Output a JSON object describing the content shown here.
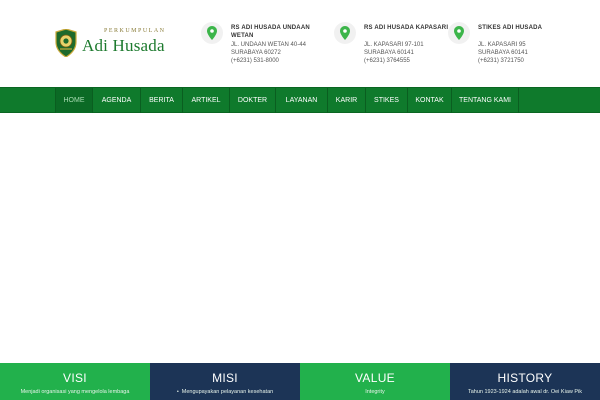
{
  "brand": {
    "tagline": "PERKUMPULAN",
    "name": "Adi Husada",
    "green": "#1d7a2e",
    "nav_green": "#0f7a2c"
  },
  "contacts": [
    {
      "name": "RS ADI HUSADA UNDAAN WETAN",
      "address": "JL. UNDAAN WETAN 40-44",
      "city": "SURABAYA 60272",
      "phone": "(+6231) 531-8000",
      "icon": "map-pin-icon"
    },
    {
      "name": "RS ADI HUSADA KAPASARI",
      "address": "JL. KAPASARI 97-101",
      "city": "SURABAYA 60141",
      "phone": "(+6231) 3764555",
      "icon": "map-pin-icon"
    },
    {
      "name": "STIKES ADI HUSADA",
      "address": "JL. KAPASARI 95",
      "city": "SURABAYA 60141",
      "phone": "(+6231) 3721750",
      "icon": "map-pin-icon"
    }
  ],
  "nav": {
    "items": [
      {
        "label": "HOME",
        "active": true
      },
      {
        "label": "AGENDA"
      },
      {
        "label": "BERITA"
      },
      {
        "label": "ARTIKEL"
      },
      {
        "label": "DOKTER"
      },
      {
        "label": "LAYANAN"
      },
      {
        "label": "KARIR"
      },
      {
        "label": "STIKES"
      },
      {
        "label": "KONTAK"
      },
      {
        "label": "TENTANG KAMI"
      }
    ]
  },
  "panels": [
    {
      "title": "VISI",
      "text": "Menjadi organisasi yang mengelola lembaga",
      "color": "#22b14c"
    },
    {
      "title": "MISI",
      "text": "Mengupayakan pelayanan kesehatan",
      "color": "#1c3456"
    },
    {
      "title": "VALUE",
      "text": "Integrity",
      "color": "#22b14c"
    },
    {
      "title": "HISTORY",
      "text": "Tahun 1923-1924 adalah awal dr. Oei Kiaw Pik",
      "color": "#1c3456"
    }
  ]
}
